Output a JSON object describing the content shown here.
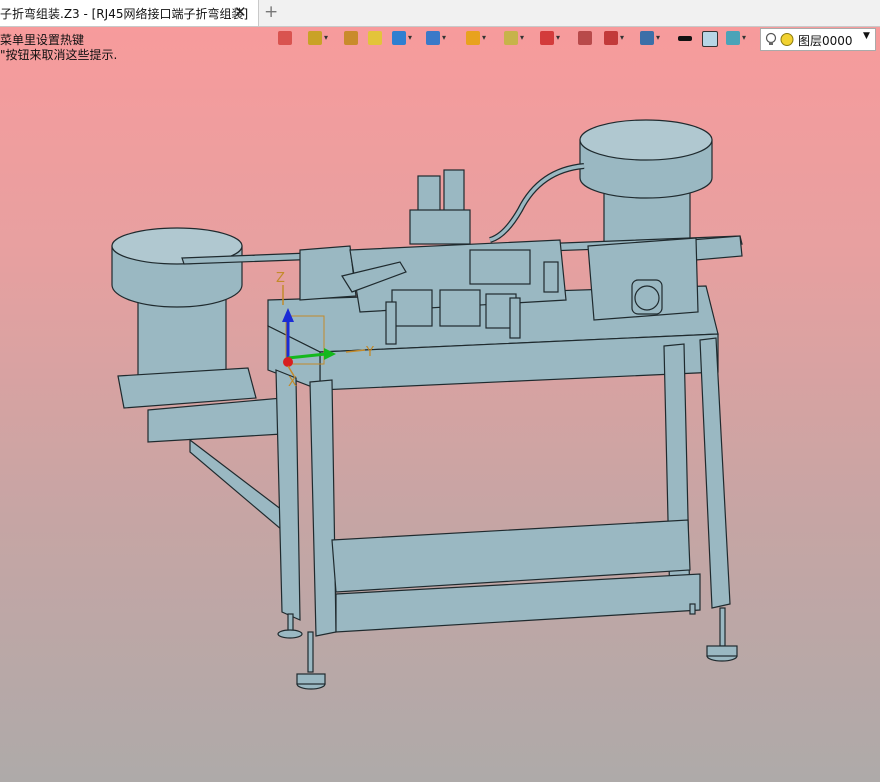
{
  "window": {
    "tab_title": "子折弯组装.Z3 - [RJ45网络接口端子折弯组装]",
    "close_glyph": "✕",
    "add_tab_glyph": "+"
  },
  "hints": [
    "菜单里设置热键",
    "\"按钮来取消这些提示."
  ],
  "toolbar": {
    "icons": [
      {
        "name": "exit-icon",
        "color": "#d9534f",
        "dropdown": false
      },
      {
        "name": "paint-bucket-icon",
        "color": "#c9a227",
        "dropdown": true
      },
      {
        "name": "pencil-icon",
        "color": "#c98b2b",
        "dropdown": false
      },
      {
        "name": "eraser-icon",
        "color": "#e3c43a",
        "dropdown": false
      },
      {
        "name": "cube-icon",
        "color": "#2f7fd1",
        "dropdown": true
      },
      {
        "name": "view-cube-icon",
        "color": "#3a79c8",
        "dropdown": true
      },
      {
        "name": "star-shape-icon",
        "color": "#e8a21e",
        "dropdown": true
      },
      {
        "name": "render-mode-icon",
        "color": "#c7b34a",
        "dropdown": true
      },
      {
        "name": "target-icon",
        "color": "#d33b3b",
        "dropdown": true
      },
      {
        "name": "frame-icon",
        "color": "#b84a4a",
        "dropdown": false
      },
      {
        "name": "dimension-icon",
        "color": "#c23a3a",
        "dropdown": true
      },
      {
        "name": "display-icon",
        "color": "#3c6fa8",
        "dropdown": true
      },
      {
        "name": "line-weight-icon",
        "color": "#111111",
        "dropdown": false
      },
      {
        "name": "color-swatch-icon",
        "color": "#b7d6e6",
        "dropdown": false
      },
      {
        "name": "layer-stack-icon",
        "color": "#4aa3b8",
        "dropdown": true
      }
    ]
  },
  "layer": {
    "name": "图层0000",
    "bulb_color": "#f2d230",
    "arrow": "▼"
  },
  "axes": {
    "x_label": "X",
    "y_label": "Y",
    "z_label": "Z"
  },
  "colors": {
    "machine_fill": "#9ab8c2",
    "machine_stroke": "#1f2a2e"
  }
}
